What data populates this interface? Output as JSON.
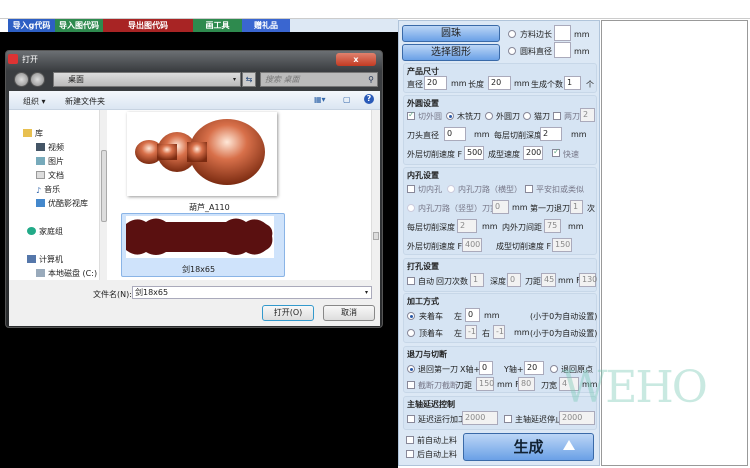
{
  "toolbar": {
    "buttons": [
      {
        "label": "导入g代码",
        "color": "#2d5fc4"
      },
      {
        "label": "导入图代码",
        "color": "#2e8a4e"
      },
      {
        "label": "导出图代码",
        "color": "#a82424"
      },
      {
        "label": "画工具",
        "color": "#2e8a4e"
      },
      {
        "label": "赠礼品",
        "color": "#3a66d0"
      }
    ]
  },
  "dialog": {
    "title": "打开",
    "close": "x",
    "address": "桌面",
    "search_placeholder": "搜索 桌面",
    "organize": "组织 ▾",
    "new_folder": "新建文件夹",
    "nav": [
      "库",
      "视频",
      "图片",
      "文档",
      "音乐",
      "优酷影视库",
      "家庭组",
      "计算机",
      "本地磁盘 (C:)"
    ],
    "files": [
      {
        "name": "葫芦_A110"
      },
      {
        "name": "剑18x65",
        "selected": true
      }
    ],
    "filename_label": "文件名(N):",
    "filename_value": "剑18x65",
    "open": "打开(O)",
    "cancel": "取消"
  },
  "panel": {
    "bead_button": "圆珠",
    "select_shape_button": "选择图形",
    "square_side": "方料边长",
    "round_dia": "圆料直径",
    "mm": "mm",
    "product": {
      "title": "产品尺寸",
      "dia_label": "直径",
      "dia": "20",
      "len_label": "长度",
      "len": "20",
      "count_label": "生成个数",
      "count": "1",
      "unit": "个"
    },
    "outer": {
      "title": "外圆设置",
      "cut_outer": "切外圆",
      "tool1": "木铣刀",
      "tool2": "外圆刀",
      "tool3": "猫刀",
      "two_blade": "两刀",
      "two_blade_val": "2",
      "tip_dia_label": "刀头直径",
      "tip_dia": "0",
      "depth_label": "每层切削深度",
      "depth": "2",
      "speed_label": "外层切削速度 F",
      "speed": "500",
      "form_label": "成型速度 F",
      "form": "200",
      "fast": "快速"
    },
    "inner": {
      "title": "内孔设置",
      "cut_inner": "切内孔",
      "path_h": "内孔刀路（横型）",
      "flat": "平安扣或类似",
      "path_v": "内孔刀路（竖型）刀宽",
      "width": "0",
      "first_label": "第一刀退刀",
      "first": "1",
      "times": "次",
      "depth_label": "每层切削深度",
      "depth": "2",
      "gap_label": "内外刀间距",
      "gap": "75",
      "speed_label": "外层切削速度 F",
      "speed": "400",
      "form_label": "成型切削速度 F",
      "form": "150"
    },
    "drill": {
      "title": "打孔设置",
      "auto": "自动",
      "back_label": "回刀次数",
      "back": "1",
      "depth_label": "深度",
      "depth": "0",
      "dist_label": "刀距",
      "dist": "45",
      "f_label": "mm F",
      "f": "130"
    },
    "method": {
      "title": "加工方式",
      "m1": "夹着车",
      "m2": "顶着车",
      "left": "左",
      "right": "右",
      "l1": "0",
      "l2": "-1",
      "r2": "-1",
      "hint": "(小于0为自动设置)"
    },
    "retract": {
      "title": "退刀与切断",
      "first": "退回第一刀",
      "x_label": "X轴+",
      "x": "0",
      "y_label": "Y轴+",
      "y": "20",
      "origin": "退回原点",
      "cutoff": "截断刀截断",
      "dist_label": "刀距",
      "dist": "150",
      "f_label": "mm F",
      "f": "80",
      "w_label": "刀宽",
      "w": "4"
    },
    "spindle": {
      "title": "主轴延迟控制",
      "start": "延迟运行加工",
      "start_val": "2000",
      "stop": "主轴延迟停止",
      "stop_val": "2000"
    },
    "front_load": "前自动上料",
    "back_load": "后自动上料",
    "generate": "生成"
  },
  "watermark": "WEHO"
}
